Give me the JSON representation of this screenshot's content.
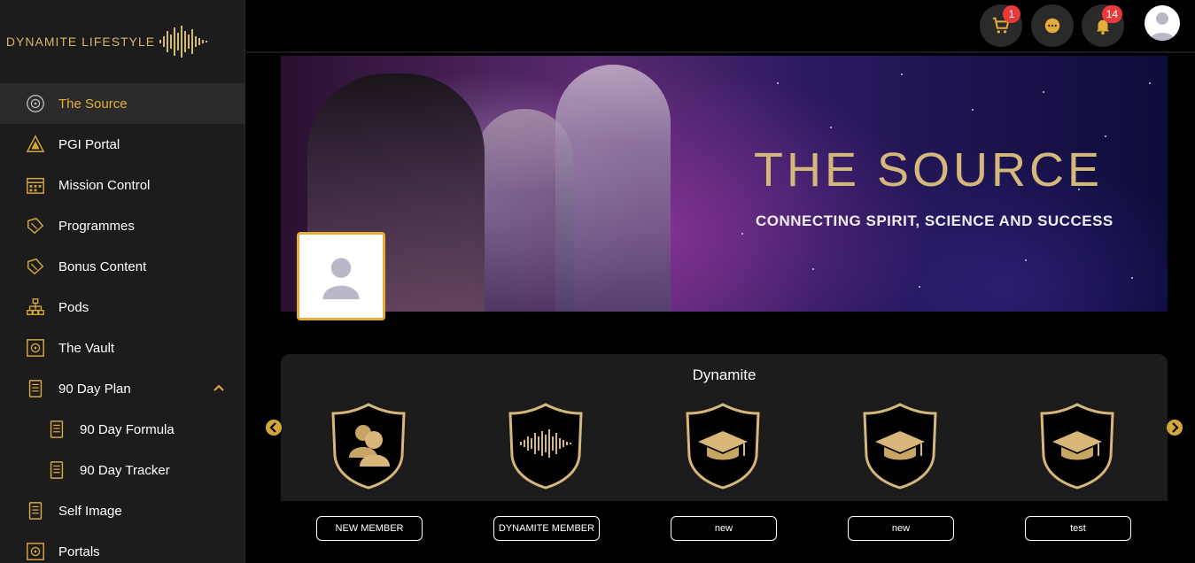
{
  "brand": {
    "name": "DYNAMITE LIFESTYLE",
    "accent": "#e4ad3b",
    "gold": "#d4b77b"
  },
  "sidebar": {
    "items": [
      {
        "label": "The Source",
        "icon": "source-icon",
        "active": true
      },
      {
        "label": "PGI Portal",
        "icon": "pyramid-icon"
      },
      {
        "label": "Mission Control",
        "icon": "calendar-icon"
      },
      {
        "label": "Programmes",
        "icon": "book-icon"
      },
      {
        "label": "Bonus Content",
        "icon": "book-icon"
      },
      {
        "label": "Pods",
        "icon": "hierarchy-icon"
      },
      {
        "label": "The Vault",
        "icon": "vault-icon"
      },
      {
        "label": "90 Day Plan",
        "icon": "planner-icon",
        "expanded": true
      },
      {
        "label": "90 Day Formula",
        "icon": "planner-icon",
        "sub": true
      },
      {
        "label": "90 Day Tracker",
        "icon": "planner-icon",
        "sub": true
      },
      {
        "label": "Self Image",
        "icon": "planner-icon"
      },
      {
        "label": "Portals",
        "icon": "vault-icon"
      }
    ]
  },
  "header": {
    "cart_count": "1",
    "notification_count": "14"
  },
  "banner": {
    "title": "THE SOURCE",
    "subtitle": "CONNECTING SPIRIT, SCIENCE AND SUCCESS"
  },
  "badges_panel": {
    "title": "Dynamite",
    "badges": [
      {
        "label": "NEW MEMBER",
        "icon": "members-icon"
      },
      {
        "label": "DYNAMITE MEMBER",
        "icon": "soundwave-icon"
      },
      {
        "label": "new",
        "icon": "graduation-cap-icon"
      },
      {
        "label": "new",
        "icon": "graduation-cap-icon"
      },
      {
        "label": "test",
        "icon": "graduation-cap-icon"
      }
    ]
  }
}
